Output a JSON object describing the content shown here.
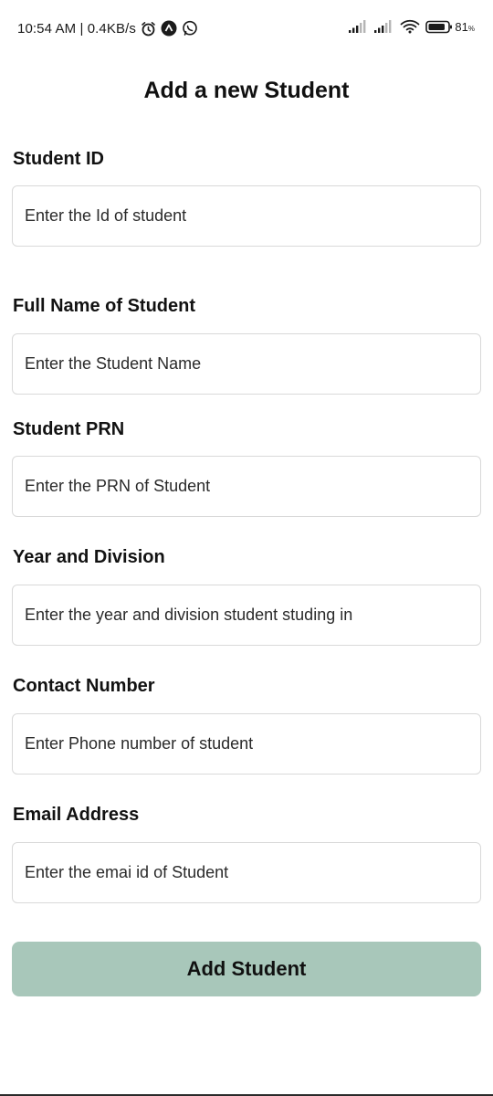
{
  "status_bar": {
    "time_speed": "10:54 AM | 0.4KB/s",
    "battery_level": "81",
    "battery_unit": "%",
    "icons": [
      "alarm-icon",
      "arrow-app-icon",
      "whatsapp-icon",
      "signal-icon",
      "signal-icon",
      "wifi-icon",
      "battery-icon"
    ]
  },
  "page": {
    "title": "Add a new Student"
  },
  "form": {
    "fields": [
      {
        "label": "Student ID",
        "placeholder": "Enter the Id of student"
      },
      {
        "label": "Full Name of Student",
        "placeholder": "Enter the Student Name"
      },
      {
        "label": "Student PRN",
        "placeholder": "Enter the PRN of Student"
      },
      {
        "label": "Year and Division",
        "placeholder": "Enter the year and division student studing in"
      },
      {
        "label": "Contact Number",
        "placeholder": "Enter Phone number of student"
      },
      {
        "label": "Email Address",
        "placeholder": "Enter the emai id of Student"
      }
    ],
    "submit_label": "Add Student"
  },
  "colors": {
    "button_bg": "#a8c7ba",
    "input_border": "#d9d9d9",
    "text": "#111111"
  }
}
